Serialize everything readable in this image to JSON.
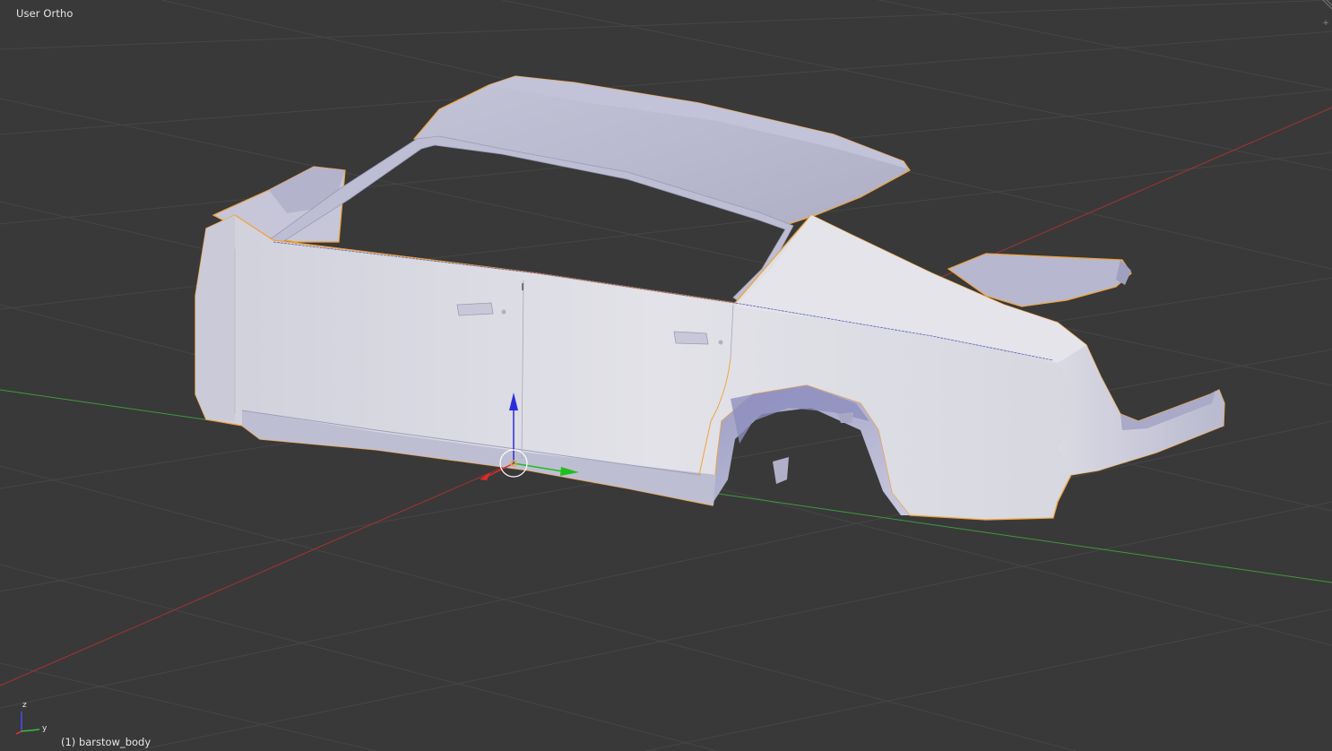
{
  "viewport": {
    "view_label": "User Ortho",
    "active_object_label": "(1) barstow_body",
    "background": "#393939",
    "grid_color": "#454545",
    "axis_x_color": "#b63434",
    "axis_y_color": "#3f9f3f"
  },
  "object": {
    "name": "barstow_body",
    "selection_outline": "#f0a33a",
    "body_color": "#d6d6e2"
  },
  "manipulator": {
    "z_arrow_color": "#2b2bdd",
    "y_arrow_color": "#1fbf1f",
    "x_arrow_color": "#dd2b2b"
  },
  "axis_widget": {
    "z_label": "z",
    "y_label": "y"
  },
  "corner_widgets": {
    "plus_icon": "+"
  }
}
